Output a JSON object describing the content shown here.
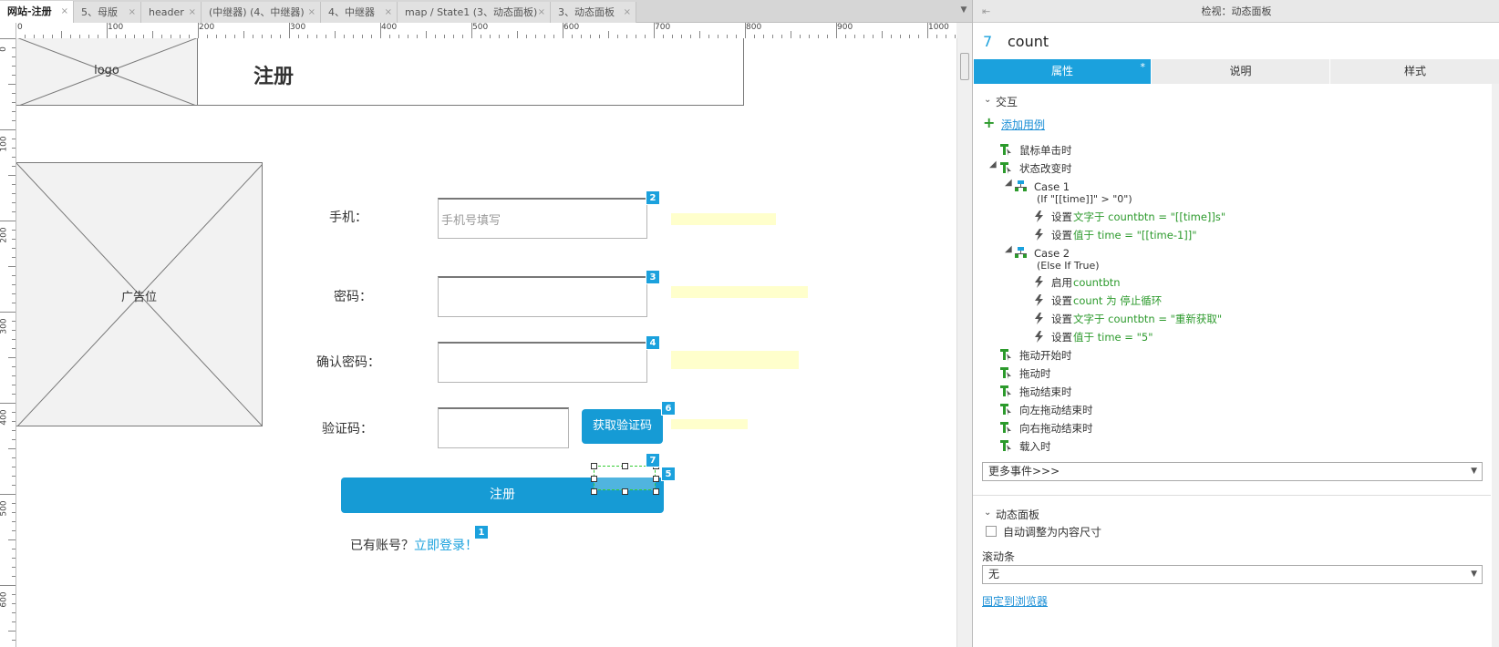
{
  "tabs": [
    {
      "label": "网站-注册",
      "active": true
    },
    {
      "label": "5、母版",
      "active": false
    },
    {
      "label": "header",
      "active": false
    },
    {
      "label": "(中继器) (4、中继器)",
      "active": false
    },
    {
      "label": "4、中继器",
      "active": false
    },
    {
      "label": "map / State1 (3、动态面板)",
      "active": false
    },
    {
      "label": "3、动态面板",
      "active": false
    }
  ],
  "tab_close": "×",
  "tab_overflow": "▼",
  "ruler": {
    "h_ticks": [
      "0",
      "100",
      "200",
      "300",
      "400",
      "500",
      "600",
      "700",
      "800",
      "900",
      "1000"
    ],
    "v_ticks": [
      "0",
      "100",
      "200",
      "300",
      "400",
      "500",
      "600"
    ]
  },
  "canvas": {
    "logo_label": "logo",
    "title": "注册",
    "ad_label": "广告位",
    "labels": {
      "phone": "手机：",
      "password": "密码：",
      "confirm": "确认密码：",
      "code": "验证码："
    },
    "phone_placeholder": "手机号填写",
    "get_code_button": "获取验证码",
    "register_button": "注册",
    "has_account": "已有账号？",
    "login_link": "立即登录！",
    "markers": [
      "1",
      "2",
      "3",
      "4",
      "5",
      "6",
      "7"
    ]
  },
  "inspector": {
    "title": "检视：动态面板",
    "pin": "⇤",
    "widget_number": "7",
    "widget_name": "count",
    "tabs": [
      {
        "label": "属性",
        "active": true,
        "mark": "*"
      },
      {
        "label": "说明",
        "active": false
      },
      {
        "label": "样式",
        "active": false
      }
    ],
    "interaction_title": "交互",
    "add_case": "添加用例",
    "events": {
      "click": "鼠标单击时",
      "state_change": "状态改变时",
      "drag_start": "拖动开始时",
      "drag": "拖动时",
      "drag_end": "拖动结束时",
      "swipe_left": "向左拖动结束时",
      "swipe_right": "向右拖动结束时",
      "load": "载入时"
    },
    "case1": {
      "name": "Case 1",
      "cond": "(If \"[[time]]\" > \"0\")",
      "a1_verb": "设置",
      "a1_detail": "文字于 countbtn = \"[[time]]s\"",
      "a2_verb": "设置",
      "a2_detail": "值于 time = \"[[time-1]]\""
    },
    "case2": {
      "name": "Case 2",
      "cond": "(Else If True)",
      "a1_verb": "启用",
      "a1_detail": "countbtn",
      "a2_verb": "设置",
      "a2_detail": "count 为 停止循环",
      "a3_verb": "设置",
      "a3_detail": "文字于 countbtn = \"重新获取\"",
      "a4_verb": "设置",
      "a4_detail": "值于 time = \"5\""
    },
    "more_events": "更多事件>>>",
    "panel_title": "动态面板",
    "auto_fit": "自动调整为内容尺寸",
    "auto_fit_checked": false,
    "scrollbar_label": "滚动条",
    "scrollbar_value": "无",
    "pin_browser": "固定到浏览器"
  },
  "colors": {
    "accent": "#1ba1dd",
    "button": "#169bd5",
    "action_green": "#2c9a2c",
    "hint_yellow": "#ffffcc"
  }
}
